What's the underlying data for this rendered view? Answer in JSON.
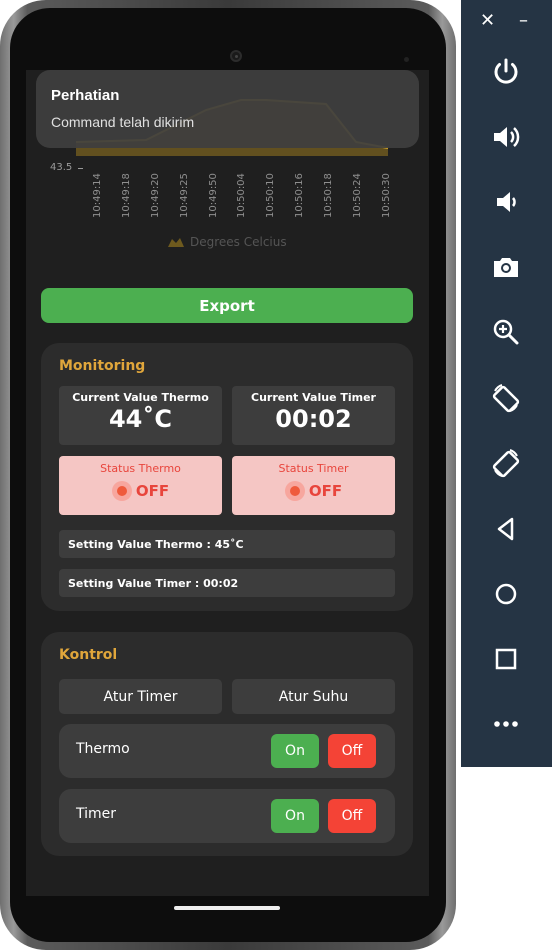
{
  "chart": {
    "y_tick": "43.5",
    "x_labels": [
      "10:49:14",
      "10:49:18",
      "10:49:20",
      "10:49:25",
      "10:49:50",
      "10:50:04",
      "10:50:10",
      "10:50:16",
      "10:50:18",
      "10:50:24",
      "10:50:30"
    ],
    "legend": "Degrees Celcius",
    "series_color": "#e0b23a"
  },
  "toast": {
    "title": "Perhatian",
    "message": "Command telah dikirim"
  },
  "export": {
    "label": "Export"
  },
  "monitoring": {
    "title": "Monitoring",
    "thermo_label": "Current Value Thermo",
    "thermo_value": "44˚C",
    "timer_label": "Current Value Timer",
    "timer_value": "00:02",
    "status_thermo_label": "Status Thermo",
    "status_thermo_value": "OFF",
    "status_timer_label": "Status Timer",
    "status_timer_value": "OFF",
    "setting_thermo": "Setting Value Thermo  : 45˚C",
    "setting_timer": "Setting Value Timer  : 00:02"
  },
  "kontrol": {
    "title": "Kontrol",
    "atur_timer": "Atur Timer",
    "atur_suhu": "Atur Suhu",
    "thermo_label": "Thermo",
    "timer_label": "Timer",
    "on_label": "On",
    "off_label": "Off"
  },
  "colors": {
    "accent": "#e0a63b",
    "green": "#4caf50",
    "red": "#f44336",
    "status_bg": "#f5c6c4"
  },
  "toolbar": {
    "close": "✕",
    "minimize": "–",
    "icons": [
      "power-icon",
      "volume-up-icon",
      "volume-down-icon",
      "camera-icon",
      "zoom-icon",
      "rotate-left-icon",
      "rotate-right-icon",
      "back-icon",
      "home-icon",
      "overview-icon",
      "more-icon"
    ]
  }
}
